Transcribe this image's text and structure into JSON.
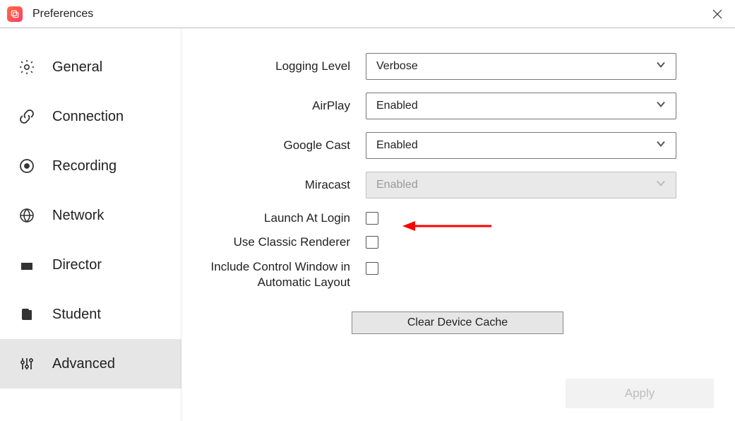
{
  "window": {
    "title": "Preferences"
  },
  "sidebar": {
    "items": [
      {
        "id": "general",
        "label": "General",
        "icon": "gear-icon",
        "active": false
      },
      {
        "id": "connection",
        "label": "Connection",
        "icon": "link-icon",
        "active": false
      },
      {
        "id": "recording",
        "label": "Recording",
        "icon": "record-icon",
        "active": false
      },
      {
        "id": "network",
        "label": "Network",
        "icon": "globe-icon",
        "active": false
      },
      {
        "id": "director",
        "label": "Director",
        "icon": "slate-icon",
        "active": false
      },
      {
        "id": "student",
        "label": "Student",
        "icon": "student-icon",
        "active": false
      },
      {
        "id": "advanced",
        "label": "Advanced",
        "icon": "sliders-icon",
        "active": true
      }
    ]
  },
  "settings": {
    "logging_level": {
      "label": "Logging Level",
      "value": "Verbose",
      "disabled": false
    },
    "airplay": {
      "label": "AirPlay",
      "value": "Enabled",
      "disabled": false
    },
    "google_cast": {
      "label": "Google Cast",
      "value": "Enabled",
      "disabled": false
    },
    "miracast": {
      "label": "Miracast",
      "value": "Enabled",
      "disabled": true
    },
    "launch_at_login": {
      "label": "Launch At Login",
      "checked": false
    },
    "use_classic_renderer": {
      "label": "Use Classic Renderer",
      "checked": false
    },
    "include_control_window": {
      "label": "Include Control Window in Automatic Layout",
      "checked": false
    },
    "clear_cache_label": "Clear Device Cache",
    "apply_label": "Apply"
  }
}
